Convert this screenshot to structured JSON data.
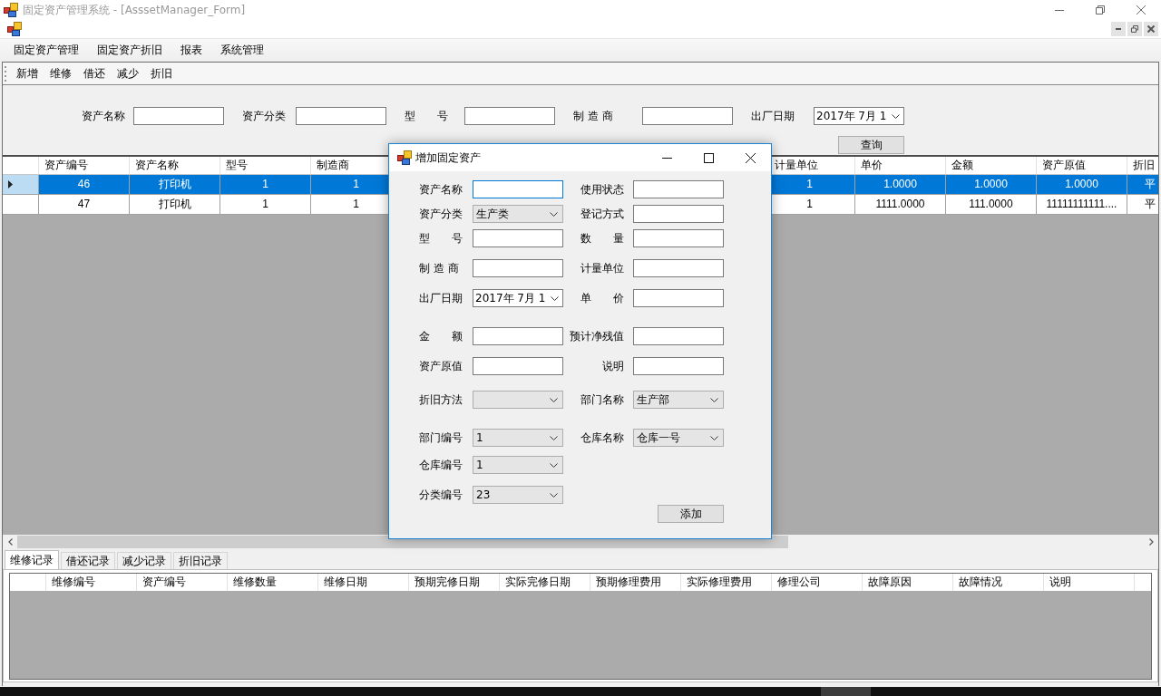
{
  "window": {
    "title": "固定资产管理系统 - [AsssetManager_Form]"
  },
  "menu": [
    "固定资产管理",
    "固定资产折旧",
    "报表",
    "系统管理"
  ],
  "toolbar": [
    "新增",
    "维修",
    "借还",
    "减少",
    "折旧"
  ],
  "search": {
    "fields": [
      {
        "label": "资产名称",
        "kind": "text"
      },
      {
        "label": "资产分类",
        "kind": "text"
      },
      {
        "label": "型　　号",
        "kind": "text"
      },
      {
        "label": "制 造 商",
        "kind": "text"
      },
      {
        "label": "出厂日期",
        "kind": "date",
        "value": "2017年 7月 1"
      }
    ],
    "button": "查询"
  },
  "asset_table": {
    "columns": [
      "资产编号",
      "资产名称",
      "型号",
      "制造商",
      "计量单位",
      "单价",
      "金额",
      "资产原值",
      "折旧"
    ],
    "rows": [
      {
        "selected": true,
        "cells": [
          "46",
          "打印机",
          "1",
          "1",
          "1",
          "1.0000",
          "1.0000",
          "1.0000",
          "平"
        ]
      },
      {
        "selected": false,
        "cells": [
          "47",
          "打印机",
          "1",
          "1",
          "1",
          "1111.0000",
          "111.0000",
          "11111111111....",
          "平"
        ]
      }
    ]
  },
  "dialog": {
    "title": "增加固定资产",
    "left_fields": [
      {
        "label": "资产名称",
        "kind": "text",
        "focused": true
      },
      {
        "label": "资产分类",
        "kind": "combo",
        "value": "生产类",
        "focused": false
      },
      {
        "label": "型　　号",
        "kind": "text",
        "focused": false
      },
      {
        "label": "制 造 商",
        "kind": "text",
        "focused": false
      },
      {
        "label": "出厂日期",
        "kind": "date",
        "value": "2017年 7月 1",
        "focused": false
      },
      {
        "label": "金　　额",
        "kind": "text",
        "focused": false
      },
      {
        "label": "资产原值",
        "kind": "text",
        "focused": false
      },
      {
        "label": "折旧方法",
        "kind": "combo",
        "focused": false
      },
      {
        "label": "部门编号",
        "kind": "combo",
        "value": "1",
        "focused": false
      },
      {
        "label": "仓库编号",
        "kind": "combo",
        "value": "1",
        "focused": false
      },
      {
        "label": "分类编号",
        "kind": "combo",
        "value": "23",
        "focused": false
      }
    ],
    "right_fields": [
      {
        "label": "使用状态",
        "kind": "text",
        "focused": false
      },
      {
        "label": "登记方式",
        "kind": "text",
        "focused": false
      },
      {
        "label": "数　　量",
        "kind": "text",
        "focused": false
      },
      {
        "label": "计量单位",
        "kind": "text",
        "focused": false
      },
      {
        "label": "单　　价",
        "kind": "text",
        "focused": false
      },
      {
        "label": "预计净残值",
        "kind": "text",
        "focused": false
      },
      {
        "label": "说明",
        "kind": "text",
        "focused": false
      },
      {
        "label": "部门名称",
        "kind": "combo",
        "value": "生产部",
        "focused": false
      },
      {
        "label": "仓库名称",
        "kind": "combo",
        "value": "仓库一号",
        "focused": false
      }
    ],
    "button": "添加"
  },
  "record_tabs": [
    {
      "label": "维修记录",
      "selected": true
    },
    {
      "label": "借还记录",
      "selected": false
    },
    {
      "label": "减少记录",
      "selected": false
    },
    {
      "label": "折旧记录",
      "selected": false
    }
  ],
  "record_table": {
    "columns": [
      "维修编号",
      "资产编号",
      "维修数量",
      "维修日期",
      "预期完修日期",
      "实际完修日期",
      "预期修理费用",
      "实际修理费用",
      "修理公司",
      "故障原因",
      "故障情况",
      "说明"
    ]
  }
}
